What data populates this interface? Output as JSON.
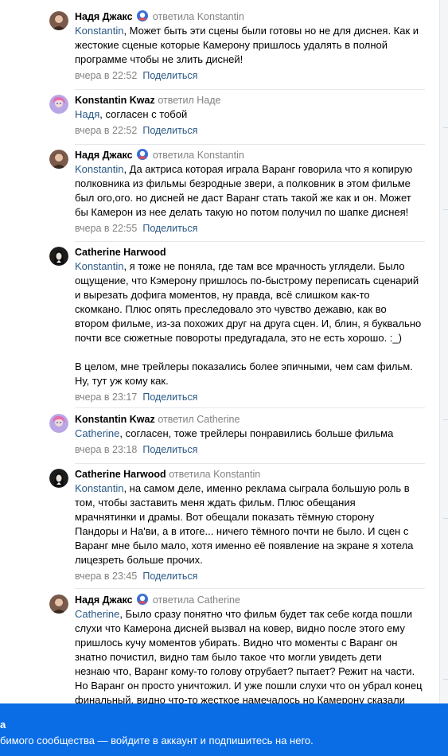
{
  "comments": [
    {
      "author": "Надя Джакс",
      "has_badge": true,
      "replied": "ответила Konstantin",
      "mention": "Konstantin",
      "text": ", Может быть эти сцены были готовы но не для диснея. Как и\nжестокие сценые которые Камерону пришлось удалять в полной\nпрограмме чтобы не злить дисней!",
      "time": "вчера в 22:52",
      "share": "Поделиться",
      "avatar": "woman-avatar"
    },
    {
      "author": "Konstantin Kwaz",
      "has_badge": false,
      "replied": "ответил Наде",
      "mention": "Надя",
      "text": ", согласен с тобой",
      "time": "вчера в 22:52",
      "share": "Поделиться",
      "avatar": "anime-avatar"
    },
    {
      "author": "Надя Джакс",
      "has_badge": true,
      "replied": "ответила Konstantin",
      "mention": "Konstantin",
      "text": ", Да актриса которая играла Варанг говорила что я копирую\nполковника из фильмы безродные звери, а полковник в этом фильме\nбыл ого,ого. но дисней не даст Варанг стать такой же как и он. Может\nбы Камерон из нее делать такую но потом получил по шапке диснея!",
      "time": "вчера в 22:55",
      "share": "Поделиться",
      "avatar": "woman-avatar"
    },
    {
      "author": "Catherine Harwood",
      "has_badge": false,
      "replied": "",
      "mention": "Konstantin",
      "text": ", я тоже не поняла, где там все мрачность углядели. Было\nощущение, что Кэмерону пришлось по-быстрому переписать сценарий\nи вырезать дофига моментов, ну правда, всё слишком как-то\nскомкано. Плюс опять преследовало это чувство дежавю, как во\nвтором фильме, из-за похожих друг на друга сцен. И, блин, я буквально\nпочти все сюжетные повороты предугадала, это не есть хорошо. :_)\n\nВ целом, мне трейлеры показались более эпичными, чем сам фильм.\nНу, тут уж кому как.",
      "time": "вчера в 23:17",
      "share": "Поделиться",
      "avatar": "dark-avatar"
    },
    {
      "author": "Konstantin Kwaz",
      "has_badge": false,
      "replied": "ответил Catherine",
      "mention": "Catherine",
      "text": ", согласен, тоже трейлеры понравились больше фильма",
      "time": "вчера в 23:18",
      "share": "Поделиться",
      "avatar": "anime-avatar"
    },
    {
      "author": "Catherine Harwood",
      "has_badge": false,
      "replied": "ответила Konstantin",
      "mention": "Konstantin",
      "text": ", на самом деле, именно реклама сыграла большую роль в\nтом, чтобы заставить меня ждать фильм. Плюс обещания\nмрачнятинки и драмы. Вот обещали показать тёмную сторону\nПандоры и На'ви, а в итоге... ничего тёмного почти не было. И сцен с\nВаранг мне было мало, хотя именно её появление на экране я хотела\nлицезреть больше прочих.",
      "time": "вчера в 23:45",
      "share": "Поделиться",
      "avatar": "dark-avatar"
    },
    {
      "author": "Надя Джакс",
      "has_badge": true,
      "replied": "ответила Catherine",
      "mention": "Catherine",
      "text": ", Было сразу понятно что фильм будет так себе когда пошли\nслухи что Камерона дисней вызвал на ковер, видно после этого ему\nпришлось кучу моментов убирать. Видно что моменты с Варанг он\nзнатно почистил, видно там было такое что могли увидеть дети\nнезнаю что, Варанг кому-то голову отрубает? пытает? Режит на части.\nНо Варанг он просто уничтожил. И уже пошли слухи что он убрал конец\nфинальный, видно что-то жесткое намечалось но Камерону сказали",
      "time": "",
      "share": "",
      "avatar": "woman-avatar"
    }
  ],
  "banner": {
    "title": "а",
    "text": "бимого сообщества — войдите в аккаунт и подпишитесь на него."
  },
  "colors": {
    "link": "#2a5885",
    "muted": "#828282",
    "banner": "#0a6de6"
  }
}
